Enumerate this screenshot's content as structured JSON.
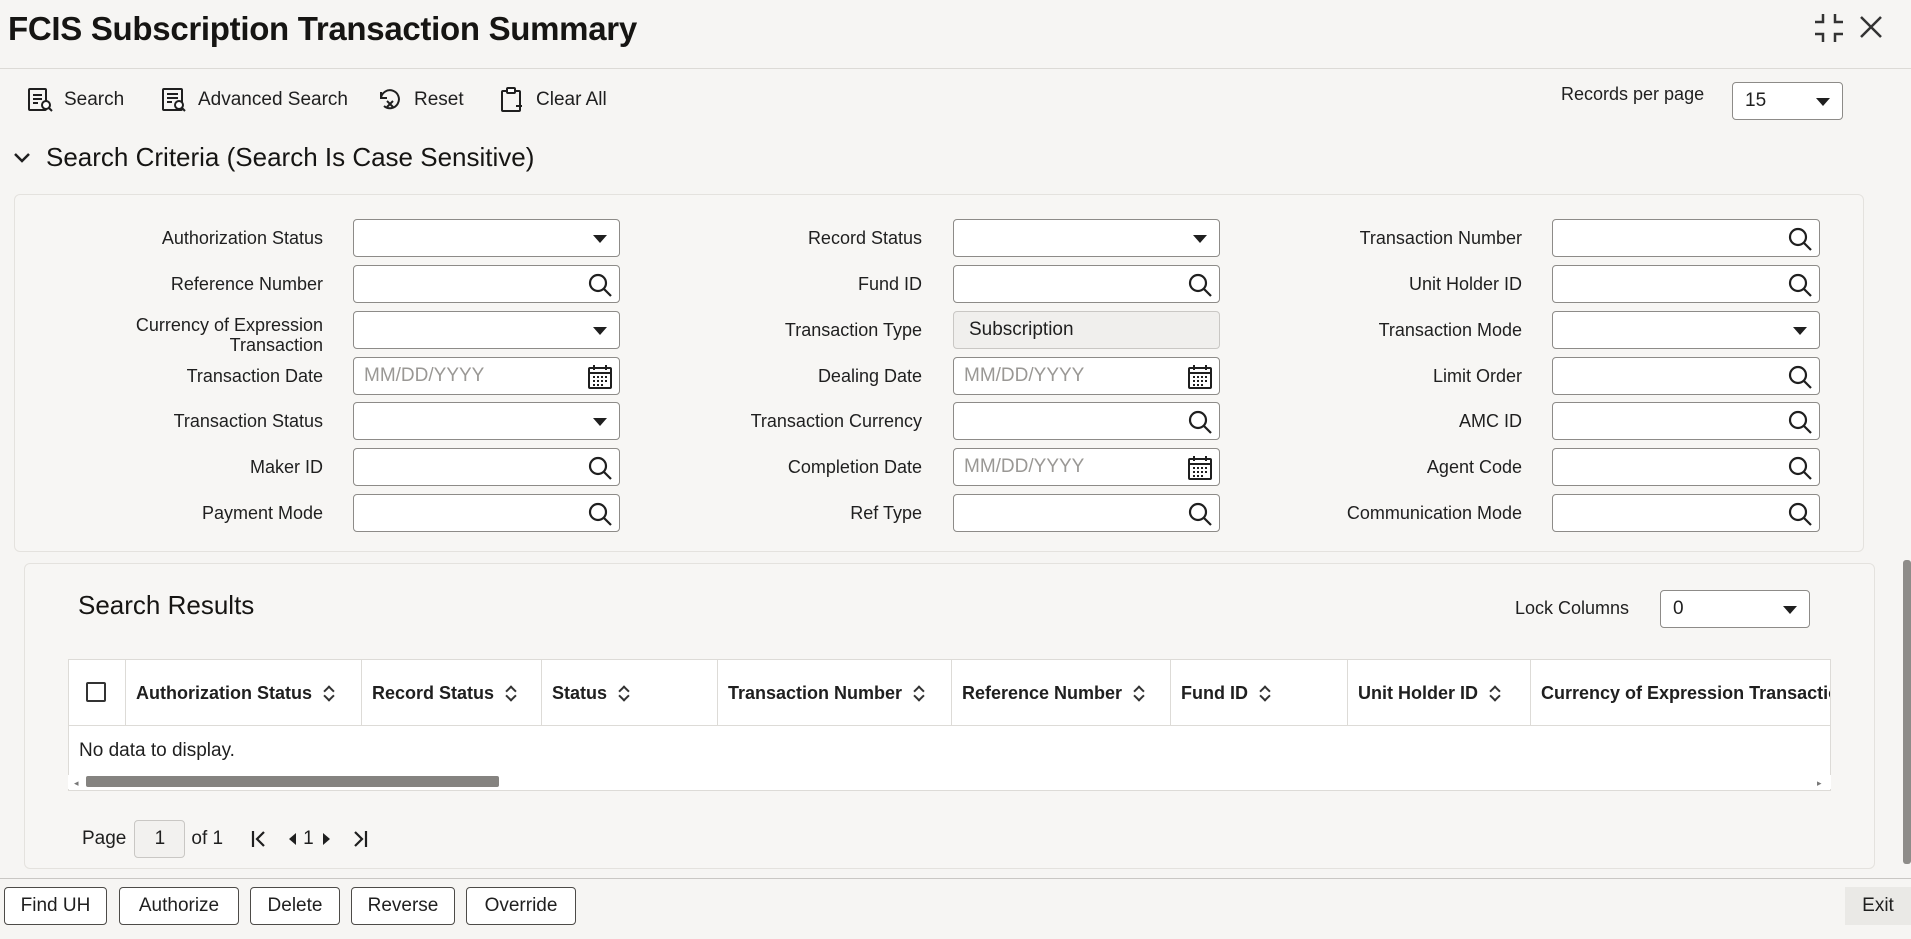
{
  "window": {
    "title": "FCIS Subscription Transaction Summary"
  },
  "toolbar": {
    "search": "Search",
    "advanced_search": "Advanced Search",
    "reset": "Reset",
    "clear_all": "Clear All",
    "records_per_page_label": "Records per page",
    "records_per_page_value": "15"
  },
  "criteria": {
    "heading": "Search Criteria (Search Is Case Sensitive)",
    "authorization_status": "Authorization Status",
    "reference_number": "Reference Number",
    "currency_expression_line1": "Currency of Expression",
    "currency_expression_line2": "Transaction",
    "transaction_date": "Transaction Date",
    "transaction_status": "Transaction Status",
    "maker_id": "Maker ID",
    "payment_mode": "Payment Mode",
    "record_status": "Record Status",
    "fund_id": "Fund ID",
    "transaction_type": "Transaction Type",
    "transaction_type_value": "Subscription",
    "dealing_date": "Dealing Date",
    "transaction_currency": "Transaction Currency",
    "completion_date": "Completion Date",
    "ref_type": "Ref Type",
    "transaction_number": "Transaction Number",
    "unit_holder_id": "Unit Holder ID",
    "transaction_mode": "Transaction Mode",
    "limit_order": "Limit Order",
    "amc_id": "AMC ID",
    "agent_code": "Agent Code",
    "communication_mode": "Communication Mode",
    "date_placeholder": "MM/DD/YYYY"
  },
  "results": {
    "heading": "Search Results",
    "lock_columns_label": "Lock Columns",
    "lock_columns_value": "0",
    "columns": [
      "Authorization Status",
      "Record Status",
      "Status",
      "Transaction Number",
      "Reference Number",
      "Fund ID",
      "Unit Holder ID",
      "Currency of Expression Transaction"
    ],
    "empty": "No data to display."
  },
  "pager": {
    "page_label": "Page",
    "page_value": "1",
    "of_label": "of 1",
    "current": "1"
  },
  "footer": {
    "find_uh": "Find UH",
    "authorize": "Authorize",
    "delete": "Delete",
    "reverse": "Reverse",
    "override": "Override",
    "exit": "Exit"
  }
}
